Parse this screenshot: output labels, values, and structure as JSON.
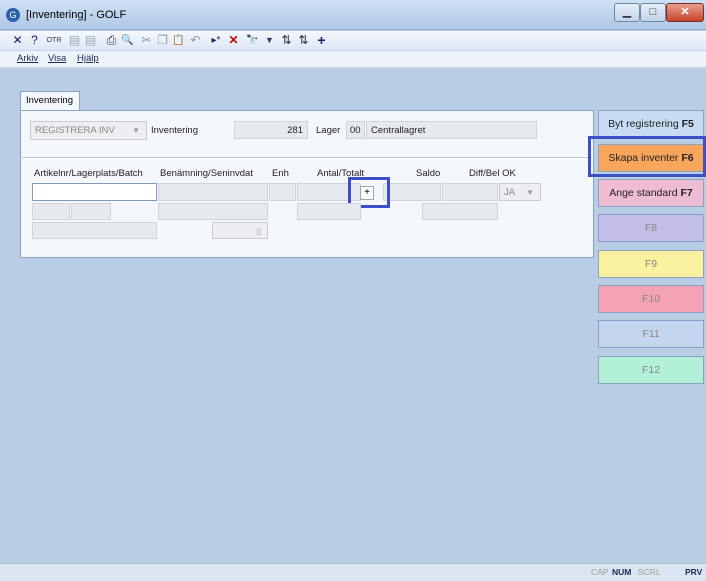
{
  "window": {
    "title": "[Inventering] - GOLF",
    "min_glyph": "▁",
    "max_glyph": "□",
    "close_glyph": "✕"
  },
  "toolbar": {
    "icons": [
      {
        "name": "delete-icon",
        "glyph": "✕",
        "color": "#1a1a6a"
      },
      {
        "name": "help-icon",
        "glyph": "?",
        "color": "#1a1a6a"
      },
      {
        "name": "otr-icon",
        "glyph": "OTR",
        "color": "#333"
      },
      {
        "name": "document-icon",
        "glyph": "▤",
        "color": "#9aa"
      },
      {
        "name": "document-copy-icon",
        "glyph": "▤",
        "color": "#9aa"
      },
      {
        "name": "print-icon",
        "glyph": "⎙",
        "color": "#333"
      },
      {
        "name": "print-preview-icon",
        "glyph": "🔍",
        "color": "#333"
      },
      {
        "name": "cut-icon",
        "glyph": "✂",
        "color": "#999"
      },
      {
        "name": "copy-icon",
        "glyph": "❐",
        "color": "#999"
      },
      {
        "name": "paste-icon",
        "glyph": "📋",
        "color": "#666"
      },
      {
        "name": "undo-icon",
        "glyph": "↶",
        "color": "#999"
      },
      {
        "name": "insert-row-icon",
        "glyph": "▸*",
        "color": "#1a1a6a"
      },
      {
        "name": "delete-row-icon",
        "glyph": "✕",
        "color": "#c00"
      },
      {
        "name": "find-icon",
        "glyph": "🔭",
        "color": "#333"
      },
      {
        "name": "filter-icon",
        "glyph": "▼",
        "color": "#336"
      },
      {
        "name": "sort-asc-icon",
        "glyph": "⇅",
        "color": "#333"
      },
      {
        "name": "sort-desc-icon",
        "glyph": "⇅",
        "color": "#333"
      },
      {
        "name": "add-icon",
        "glyph": "+",
        "color": "#1a1a6a"
      }
    ]
  },
  "menu": {
    "items": [
      "Arkiv",
      "Visa",
      "Hjälp"
    ]
  },
  "tab": {
    "label": "Inventering"
  },
  "header": {
    "registration_type": "REGISTRERA INV",
    "inventering_label": "Inventering",
    "inventering_number": "281",
    "lager_label": "Lager",
    "lager_code": "00",
    "lager_name": "Centrallagret"
  },
  "columns": {
    "artikel": "Artikelnr/Lagerplats/Batch",
    "benamning": "Benämning/Seninvdat",
    "enh": "Enh",
    "antal": "Antal/Totalt",
    "saldo": "Saldo",
    "diff": "Diff/Bel OK"
  },
  "row": {
    "ok_value": "JA",
    "plus_label": "+"
  },
  "fkeys": [
    {
      "label": "Byt registrering ",
      "key": "F5",
      "bg": "#c7dbf3"
    },
    {
      "label": "Skapa inventer ",
      "key": "F6",
      "bg": "#f7a65c"
    },
    {
      "label": "Ange standard ",
      "key": "F7",
      "bg": "#eebdd3"
    },
    {
      "label": "F8",
      "key": "",
      "bg": "#c3bee8"
    },
    {
      "label": "F9",
      "key": "",
      "bg": "#fbf2a0"
    },
    {
      "label": "F10",
      "key": "",
      "bg": "#f3a3b4"
    },
    {
      "label": "F11",
      "key": "",
      "bg": "#c4d6ef"
    },
    {
      "label": "F12",
      "key": "",
      "bg": "#b3f0d8"
    }
  ],
  "status": {
    "cap": "CAP",
    "num": "NUM",
    "scrl": "SCRL",
    "prv": "PRV"
  }
}
